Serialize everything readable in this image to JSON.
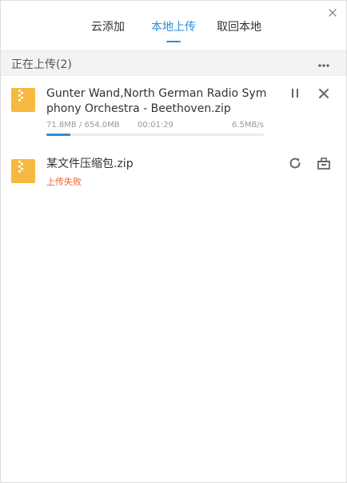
{
  "tabs": [
    {
      "label": "云添加",
      "active": false
    },
    {
      "label": "本地上传",
      "active": true
    },
    {
      "label": "取回本地",
      "active": false
    }
  ],
  "colors": {
    "accent": "#2a8fd8",
    "error": "#e8623a",
    "file_icon": "#f5b942"
  },
  "section": {
    "title": "正在上传(2)"
  },
  "uploads": [
    {
      "name": "Gunter Wand,North German Radio Symphony Orchestra - Beethoven.zip",
      "size_text": "71.8MB / 654.0MB",
      "elapsed": "00:01:29",
      "speed": "6.5MB/s",
      "progress": 0.11,
      "icon": "zip-file-icon",
      "actions": [
        "pause-icon",
        "close-icon"
      ]
    },
    {
      "name": "某文件压缩包.zip",
      "status": "上传失败",
      "icon": "zip-file-icon",
      "actions": [
        "retry-icon",
        "delete-icon"
      ]
    }
  ]
}
